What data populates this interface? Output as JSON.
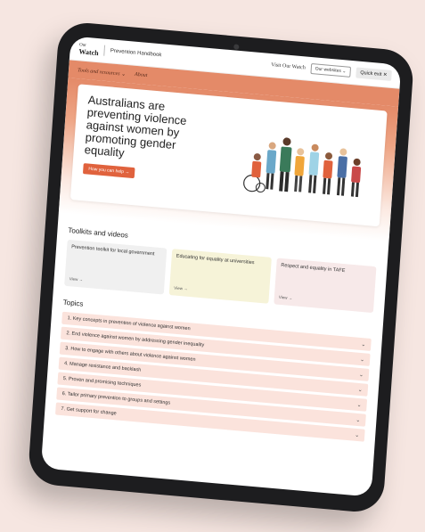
{
  "header": {
    "logo_line1": "Our",
    "logo_line2": "Watch",
    "handbook": "Prevention Handbook",
    "visit": "Visit Our Watch",
    "our_websites": "Our websites ⌄",
    "quick_exit": "Quick exit ✕"
  },
  "nav": {
    "items": [
      {
        "label": "Tools and resources ⌄"
      },
      {
        "label": "About"
      }
    ]
  },
  "hero": {
    "title": "Australians are preventing violence against women by promoting gender equality",
    "button": "How you can help →"
  },
  "toolkits": {
    "title": "Toolkits and videos",
    "cards": [
      {
        "title": "Prevention toolkit for local government",
        "view": "View →"
      },
      {
        "title": "Educating for equality at universities",
        "view": "View →"
      },
      {
        "title": "Respect and equality in TAFE",
        "view": "View →"
      }
    ]
  },
  "topics": {
    "title": "Topics",
    "items": [
      {
        "label": "1. Key concepts in prevention of violence against women"
      },
      {
        "label": "2. End violence against women by addressing gender inequality"
      },
      {
        "label": "3. How to engage with others about violence against women"
      },
      {
        "label": "4. Manage resistance and backlash"
      },
      {
        "label": "5. Proven and promising techniques"
      },
      {
        "label": "6. Tailor primary prevention to groups and settings"
      },
      {
        "label": "7. Get support for change"
      }
    ]
  },
  "colors": {
    "background": "#f6e6e1",
    "nav": "#e48a68",
    "accent_button": "#e0623d",
    "topic_row": "#fbe3dc"
  }
}
